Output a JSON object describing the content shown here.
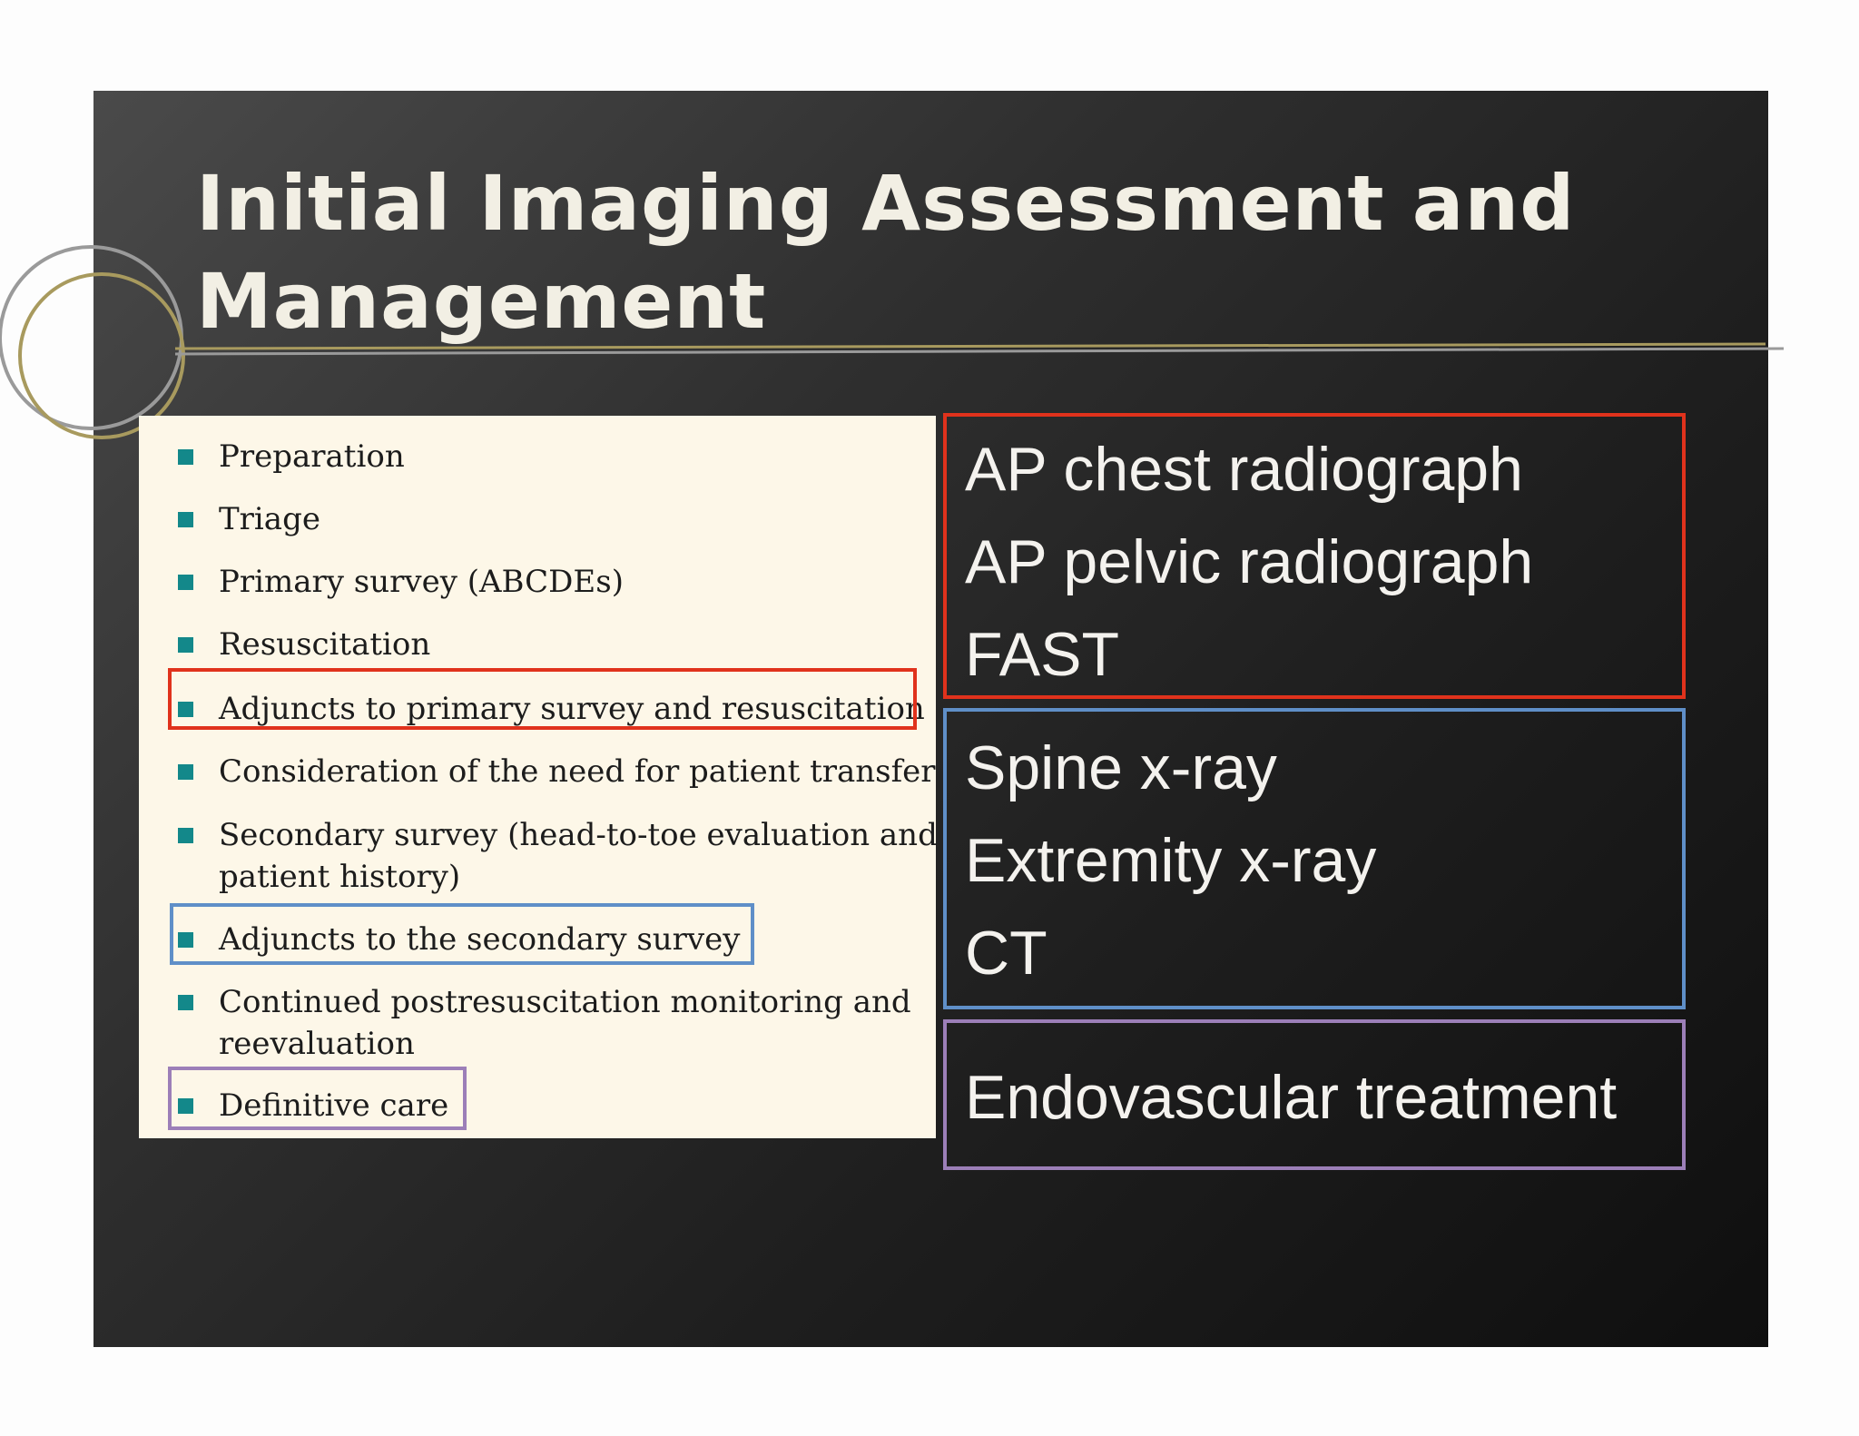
{
  "slide": {
    "title": "Initial Imaging Assessment and Management",
    "title_lines": [
      "Initial Imaging Assessment and",
      "Management"
    ]
  },
  "checklist": {
    "bullet_color": "#13888a",
    "items": [
      {
        "lines": [
          "Preparation"
        ],
        "highlight": null
      },
      {
        "lines": [
          "Triage"
        ],
        "highlight": null
      },
      {
        "lines": [
          "Primary survey (ABCDEs)"
        ],
        "highlight": null
      },
      {
        "lines": [
          "Resuscitation"
        ],
        "highlight": null
      },
      {
        "lines": [
          "Adjuncts to primary survey and resuscitation"
        ],
        "highlight": "red"
      },
      {
        "lines": [
          "Consideration of the need for patient transfer"
        ],
        "highlight": null
      },
      {
        "lines": [
          "Secondary survey (head-to-toe evaluation and",
          "patient history)"
        ],
        "highlight": null
      },
      {
        "lines": [
          "Adjuncts to the secondary survey"
        ],
        "highlight": "blue"
      },
      {
        "lines": [
          "Continued postresuscitation monitoring and",
          "reevaluation"
        ],
        "highlight": null
      },
      {
        "lines": [
          "Definitive care"
        ],
        "highlight": "purple"
      }
    ]
  },
  "imaging_groups": [
    {
      "color": "#e0321c",
      "lines": [
        "AP chest radiograph",
        "AP pelvic radiograph",
        "FAST"
      ]
    },
    {
      "color": "#5f8fc8",
      "lines": [
        "Spine x-ray",
        "Extremity x-ray",
        "CT"
      ]
    },
    {
      "color": "#9c7fb8",
      "lines": [
        "Endovascular treatment"
      ]
    }
  ],
  "colors": {
    "red": "#e0321c",
    "blue": "#5f8fc8",
    "purple": "#9c7fb8",
    "title": "#f2efe4",
    "decor_gold": "#a89a5e",
    "decor_gray": "#9a9a9a"
  }
}
